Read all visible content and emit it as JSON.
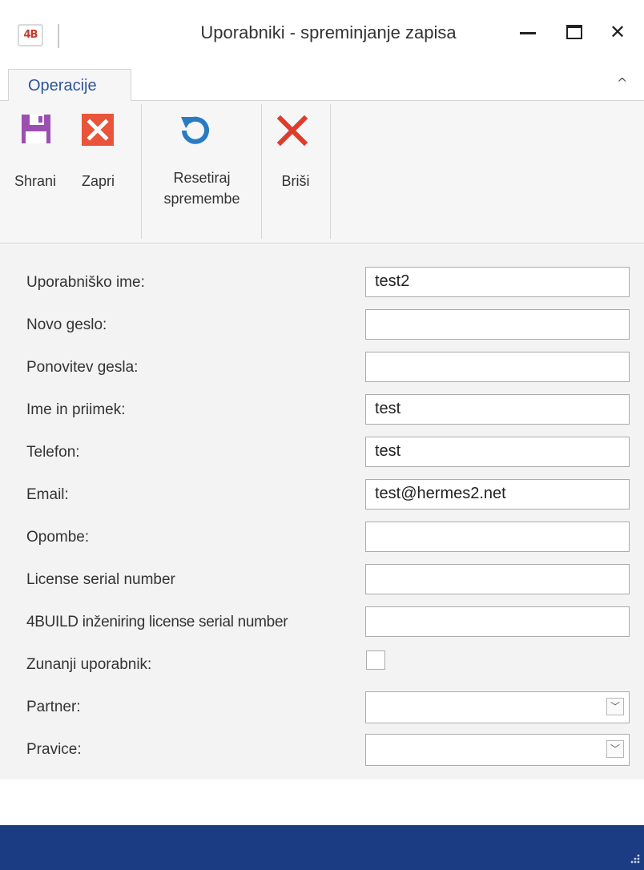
{
  "window": {
    "logo_text": "4B",
    "title": "Uporabniki - spreminjanje zapisa",
    "minimize_icon": "minimize-icon",
    "maximize_icon": "maximize-icon",
    "close_icon": "close-icon"
  },
  "ribbon": {
    "tab_label": "Operacije",
    "collapse_icon": "chevron-up-icon",
    "buttons": {
      "save": {
        "label": "Shrani",
        "icon": "floppy-disk-icon",
        "color": "#9b4fb0"
      },
      "close": {
        "label": "Zapri",
        "icon": "close-box-icon",
        "color": "#e8553a"
      },
      "reset": {
        "label_line1": "Resetiraj",
        "label_line2": "spremembe",
        "icon": "refresh-icon",
        "color": "#2a7bc3"
      },
      "delete": {
        "label": "Briši",
        "icon": "delete-x-icon",
        "color": "#e03c2b"
      }
    }
  },
  "form": {
    "username": {
      "label": "Uporabniško ime:",
      "value": "test2"
    },
    "new_password": {
      "label": "Novo geslo:",
      "value": ""
    },
    "repeat_password": {
      "label": "Ponovitev gesla:",
      "value": ""
    },
    "full_name": {
      "label": "Ime in priimek:",
      "value": "test"
    },
    "phone": {
      "label": "Telefon:",
      "value": "test"
    },
    "email": {
      "label": "Email:",
      "value": "test@hermes2.net"
    },
    "notes": {
      "label": "Opombe:",
      "value": ""
    },
    "license_serial": {
      "label": "License serial number",
      "value": ""
    },
    "engineering_license_serial": {
      "label": "4BUILD inženiring license serial number",
      "value": ""
    },
    "external_user": {
      "label": "Zunanji uporabnik:",
      "checked": false
    },
    "partner": {
      "label": "Partner:",
      "value": ""
    },
    "rights": {
      "label": "Pravice:",
      "value": ""
    }
  },
  "colors": {
    "statusbar": "#1b3c82",
    "tab_text": "#2f5597"
  }
}
